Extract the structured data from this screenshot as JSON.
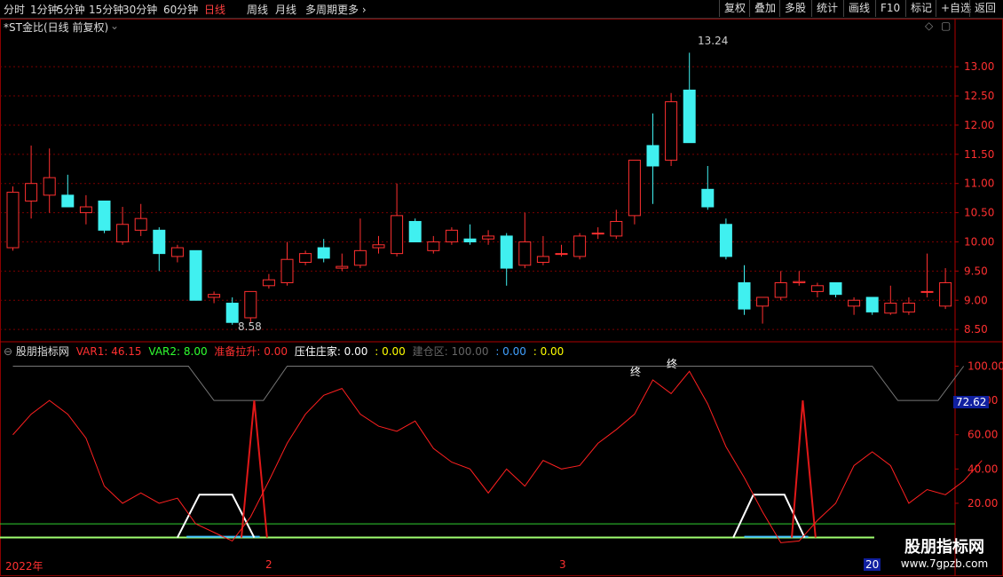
{
  "toolbar": {
    "periods": [
      "分时",
      "1分钟",
      "5分钟",
      "15分钟",
      "30分钟",
      "60分钟",
      "日线",
      "周线",
      "月线",
      "多周期",
      "更多"
    ],
    "active_period": "日线",
    "right_buttons": [
      "复权",
      "叠加",
      "多股",
      "统计",
      "画线",
      "F10",
      "标记",
      "+自选",
      "返回"
    ]
  },
  "main_panel": {
    "title": "*ST金比(日线 前复权)",
    "high_label": "13.24",
    "low_label": "8.58"
  },
  "indicator_panel": {
    "name": "股朋指标网",
    "var1_label": "VAR1: 46.15",
    "var2_label": "VAR2: 8.00",
    "prepare_label": "准备拉升: 0.00",
    "pressure_label": "压住庄家: 0.00",
    "pressure_extra": ": 0.00",
    "build_label": "建仓区: 100.00",
    "build_extra1": ": 0.00",
    "build_extra2": ": 0.00",
    "value_marker": "72.62",
    "end_marker": "终",
    "colors": {
      "var1": "#ff3030",
      "var2": "#30ff30",
      "prepare": "#ff3030",
      "pressure": "#ffffff",
      "pressure_extra": "#ffff00",
      "build": "#666666",
      "build_extra1": "#40a0ff",
      "build_extra2": "#ffff00"
    }
  },
  "time_axis": {
    "labels": [
      "2022年",
      "2",
      "3",
      "20"
    ]
  },
  "watermark": {
    "line1": "股朋指标网",
    "line2": "www.7gpzb.com"
  },
  "chart_data": [
    {
      "type": "candlestick",
      "title": "*ST金比(日线 前复权)",
      "y_ticks": [
        8.5,
        9.0,
        9.5,
        10.0,
        10.5,
        11.0,
        11.5,
        12.0,
        12.5,
        13.0
      ],
      "ylim": [
        8.35,
        13.55
      ],
      "colors": {
        "up": "#ff3030",
        "down": "#40f0f0"
      },
      "candles": [
        {
          "o": 9.9,
          "h": 10.95,
          "l": 9.85,
          "c": 10.85
        },
        {
          "o": 10.7,
          "h": 11.65,
          "l": 10.4,
          "c": 11.0
        },
        {
          "o": 10.8,
          "h": 11.6,
          "l": 10.5,
          "c": 11.1
        },
        {
          "o": 10.8,
          "h": 11.15,
          "l": 10.6,
          "c": 10.6
        },
        {
          "o": 10.5,
          "h": 10.8,
          "l": 10.3,
          "c": 10.6
        },
        {
          "o": 10.7,
          "h": 10.7,
          "l": 10.15,
          "c": 10.2
        },
        {
          "o": 10.0,
          "h": 10.6,
          "l": 9.95,
          "c": 10.3
        },
        {
          "o": 10.2,
          "h": 10.65,
          "l": 10.1,
          "c": 10.4
        },
        {
          "o": 10.2,
          "h": 10.25,
          "l": 9.5,
          "c": 9.8
        },
        {
          "o": 9.75,
          "h": 9.95,
          "l": 9.65,
          "c": 9.9
        },
        {
          "o": 9.85,
          "h": 9.85,
          "l": 9.0,
          "c": 9.0
        },
        {
          "o": 9.05,
          "h": 9.15,
          "l": 8.95,
          "c": 9.1
        },
        {
          "o": 8.95,
          "h": 9.05,
          "l": 8.58,
          "c": 8.62
        },
        {
          "o": 8.7,
          "h": 9.15,
          "l": 8.62,
          "c": 9.15
        },
        {
          "o": 9.25,
          "h": 9.45,
          "l": 9.2,
          "c": 9.35
        },
        {
          "o": 9.3,
          "h": 10.0,
          "l": 9.25,
          "c": 9.7
        },
        {
          "o": 9.65,
          "h": 9.85,
          "l": 9.6,
          "c": 9.8
        },
        {
          "o": 9.9,
          "h": 10.05,
          "l": 9.65,
          "c": 9.72
        },
        {
          "o": 9.55,
          "h": 9.8,
          "l": 9.5,
          "c": 9.58
        },
        {
          "o": 9.6,
          "h": 10.4,
          "l": 9.55,
          "c": 9.85
        },
        {
          "o": 9.9,
          "h": 10.1,
          "l": 9.8,
          "c": 9.95
        },
        {
          "o": 9.8,
          "h": 11.0,
          "l": 9.75,
          "c": 10.45
        },
        {
          "o": 10.35,
          "h": 10.4,
          "l": 10.0,
          "c": 10.0
        },
        {
          "o": 9.85,
          "h": 10.1,
          "l": 9.8,
          "c": 10.0
        },
        {
          "o": 10.0,
          "h": 10.25,
          "l": 9.95,
          "c": 10.2
        },
        {
          "o": 10.05,
          "h": 10.3,
          "l": 9.95,
          "c": 10.0
        },
        {
          "o": 10.05,
          "h": 10.2,
          "l": 9.95,
          "c": 10.1
        },
        {
          "o": 10.1,
          "h": 10.15,
          "l": 9.25,
          "c": 9.55
        },
        {
          "o": 9.6,
          "h": 10.5,
          "l": 9.55,
          "c": 10.0
        },
        {
          "o": 9.65,
          "h": 10.1,
          "l": 9.6,
          "c": 9.75
        },
        {
          "o": 9.8,
          "h": 9.95,
          "l": 9.75,
          "c": 9.8
        },
        {
          "o": 9.75,
          "h": 10.15,
          "l": 9.7,
          "c": 10.1
        },
        {
          "o": 10.15,
          "h": 10.25,
          "l": 10.05,
          "c": 10.15
        },
        {
          "o": 10.1,
          "h": 10.55,
          "l": 10.05,
          "c": 10.35
        },
        {
          "o": 10.45,
          "h": 11.4,
          "l": 10.3,
          "c": 11.4
        },
        {
          "o": 11.65,
          "h": 12.2,
          "l": 10.65,
          "c": 11.3
        },
        {
          "o": 11.4,
          "h": 12.55,
          "l": 11.3,
          "c": 12.4
        },
        {
          "o": 12.6,
          "h": 13.24,
          "l": 11.7,
          "c": 11.7
        },
        {
          "o": 10.9,
          "h": 11.3,
          "l": 10.55,
          "c": 10.6
        },
        {
          "o": 10.3,
          "h": 10.4,
          "l": 9.7,
          "c": 9.75
        },
        {
          "o": 9.3,
          "h": 9.6,
          "l": 8.75,
          "c": 8.85
        },
        {
          "o": 8.9,
          "h": 9.05,
          "l": 8.6,
          "c": 9.05
        },
        {
          "o": 9.05,
          "h": 9.5,
          "l": 9.0,
          "c": 9.3
        },
        {
          "o": 9.3,
          "h": 9.5,
          "l": 9.25,
          "c": 9.32
        },
        {
          "o": 9.15,
          "h": 9.3,
          "l": 9.05,
          "c": 9.25
        },
        {
          "o": 9.3,
          "h": 9.3,
          "l": 9.05,
          "c": 9.1
        },
        {
          "o": 8.9,
          "h": 9.05,
          "l": 8.75,
          "c": 9.0
        },
        {
          "o": 9.05,
          "h": 9.05,
          "l": 8.75,
          "c": 8.8
        },
        {
          "o": 8.78,
          "h": 9.25,
          "l": 8.75,
          "c": 8.95
        },
        {
          "o": 8.8,
          "h": 9.05,
          "l": 8.75,
          "c": 8.95
        },
        {
          "o": 9.15,
          "h": 9.8,
          "l": 9.05,
          "c": 9.15
        },
        {
          "o": 8.9,
          "h": 9.55,
          "l": 8.85,
          "c": 9.3
        }
      ]
    },
    {
      "type": "line",
      "title": "股朋指标网",
      "y_ticks": [
        20.0,
        40.0,
        60.0,
        80.0,
        100.0
      ],
      "ylim": [
        -8,
        107
      ],
      "series": [
        {
          "name": "VAR1",
          "color": "#ff2020",
          "values": [
            60,
            72,
            80,
            72,
            58,
            30,
            20,
            26,
            20,
            23,
            8,
            3,
            -2,
            12,
            33,
            55,
            72,
            83,
            87,
            72,
            65,
            62,
            68,
            52,
            44,
            40,
            26,
            40,
            30,
            45,
            40,
            42,
            55,
            63,
            72,
            92,
            84,
            97,
            78,
            53,
            35,
            15,
            -3,
            -2,
            10,
            20,
            42,
            50,
            42,
            20,
            28,
            25,
            33,
            45
          ]
        },
        {
          "name": "VAR2",
          "color": "#30ff30",
          "values": [
            8,
            8,
            8,
            8,
            8,
            8,
            8,
            8,
            8,
            8,
            8,
            8,
            8,
            8,
            8,
            8,
            8,
            8,
            8,
            8,
            8,
            8,
            8,
            8,
            8,
            8,
            8,
            8,
            8,
            8,
            8,
            8,
            8,
            8,
            8,
            8,
            8,
            8,
            8,
            8,
            8,
            8,
            8,
            8,
            8,
            8,
            8,
            8,
            8,
            8,
            8,
            8,
            8,
            8
          ]
        }
      ]
    }
  ]
}
